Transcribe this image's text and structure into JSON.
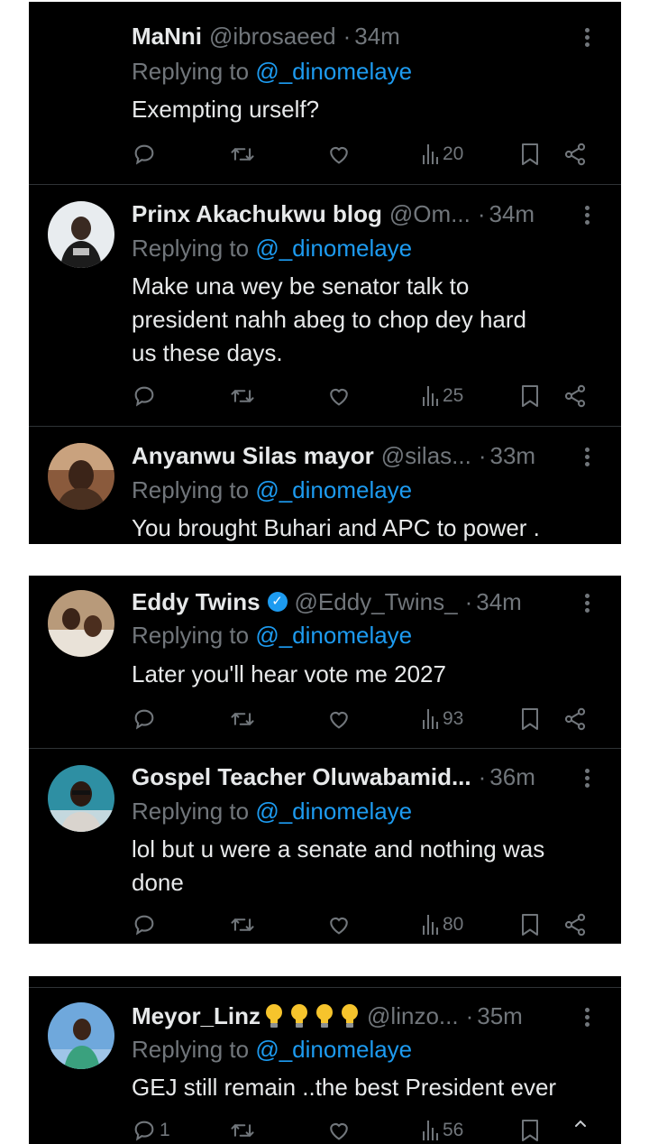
{
  "colors": {
    "background": "#000000",
    "text": "#e7e9ea",
    "muted": "#71767b",
    "mention": "#1d9bf0",
    "separator": "#2f3336"
  },
  "replying_prefix": "Replying to",
  "icons": {
    "reply": "reply-icon",
    "repost": "repost-icon",
    "like": "heart-icon",
    "views": "views-icon",
    "bookmark": "bookmark-icon",
    "share": "share-icon",
    "more": "more-icon"
  },
  "tweets": [
    {
      "name": "MaNni",
      "handle": "@ibrosaeed",
      "sep": "·",
      "time": "34m",
      "mention": "@_dinomelaye",
      "lines": [
        "Exempting urself?"
      ],
      "replies": "",
      "views": "20"
    },
    {
      "name": "Prinx Akachukwu blog",
      "handle": "@Om...",
      "sep": "·",
      "time": "34m",
      "mention": "@_dinomelaye",
      "lines": [
        "Make una wey be senator talk to",
        "president nahh abeg  to chop dey hard",
        "us these days."
      ],
      "replies": "",
      "views": "25"
    },
    {
      "name": "Anyanwu Silas mayor",
      "handle": "@silas...",
      "sep": "·",
      "time": "33m",
      "mention": "@_dinomelaye",
      "lines": [
        "You brought Buhari and APC to power ."
      ]
    },
    {
      "name": "Eddy Twins",
      "verified": true,
      "handle": "@Eddy_Twins_",
      "sep": "·",
      "time": "34m",
      "mention": "@_dinomelaye",
      "lines": [
        "Later you'll hear vote me 2027"
      ],
      "replies": "",
      "views": "93"
    },
    {
      "name": "Gospel Teacher Oluwabamid...",
      "handle": "",
      "sep": "·",
      "time": "36m",
      "mention": "@_dinomelaye",
      "lines": [
        "lol but u were a senate and nothing was",
        "done"
      ],
      "replies": "",
      "views": "80"
    },
    {
      "name": "Meyor_Linz",
      "handle": "@linzo...",
      "sep": "·",
      "time": "35m",
      "mention": "@_dinomelaye",
      "lines": [
        "GEJ still remain ..the best President ever"
      ],
      "replies": "1",
      "views": "56"
    }
  ]
}
